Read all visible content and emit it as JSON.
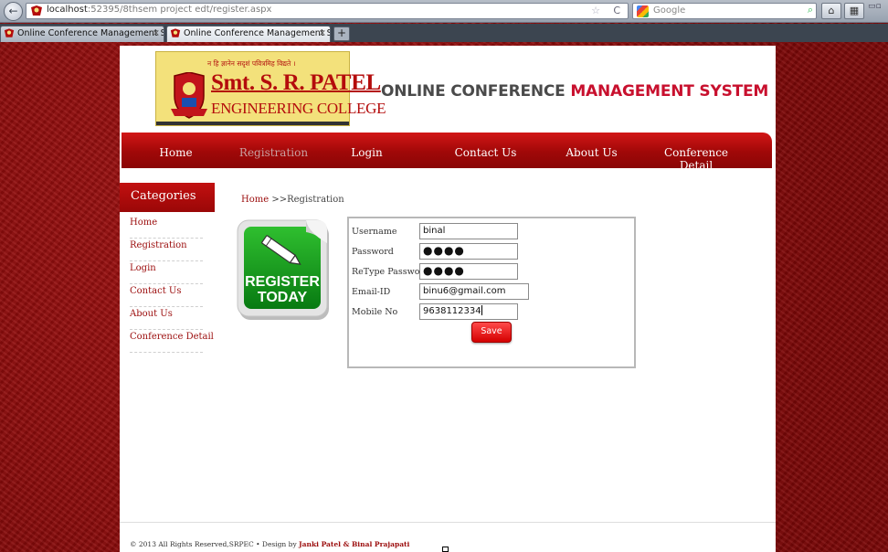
{
  "browser": {
    "url_host": "localhost",
    "url_rest": ":52395/8thsem project edt/register.aspx",
    "search_placeholder": "Google",
    "tabs": [
      {
        "label": "Online Conference Management Syst..."
      },
      {
        "label": "Online Conference Management Syst..."
      }
    ],
    "new_tab_label": "+"
  },
  "header": {
    "logo": {
      "tagline": "न हि ज्ञानेन सदृशं पवित्रमिह विद्यते ।",
      "name": "Smt. S. R. PATEL",
      "subtitle": "ENGINEERING COLLEGE"
    },
    "title_part1": "ONLINE CONFERENCE ",
    "title_part2": "MANAGEMENT SYSTEM"
  },
  "nav": {
    "items": [
      {
        "label": "Home"
      },
      {
        "label": "Registration"
      },
      {
        "label": "Login"
      },
      {
        "label": "Contact Us"
      },
      {
        "label": "About Us"
      },
      {
        "label": "Conference Detail"
      }
    ]
  },
  "sidebar": {
    "title": "Categories",
    "items": [
      {
        "label": "Home"
      },
      {
        "label": "Registration"
      },
      {
        "label": "Login"
      },
      {
        "label": "Contact Us"
      },
      {
        "label": "About Us"
      },
      {
        "label": "Conference Detail"
      }
    ]
  },
  "breadcrumb": {
    "home": "Home",
    "current": " >>Registration"
  },
  "badge": {
    "line1": "REGISTER",
    "line2": "TODAY"
  },
  "form": {
    "username_label": "Username",
    "username_value": "binal",
    "password_label": "Password",
    "password_value": "●●●●",
    "retype_label": "ReType Password",
    "retype_value": "●●●●",
    "email_label": "Email-ID",
    "email_value": "binu6@gmail.com",
    "mobile_label": "Mobile No",
    "mobile_value": "9638112334",
    "save_label": "Save"
  },
  "footer": {
    "copyright": "© 2013 All Rights Reserved,SRPEC • Design by ",
    "designers": "Janki Patel & Binal Prajapati"
  },
  "colors": {
    "brand_red": "#c8102e",
    "nav_red": "#a00808",
    "link_red": "#9b0c0c"
  }
}
